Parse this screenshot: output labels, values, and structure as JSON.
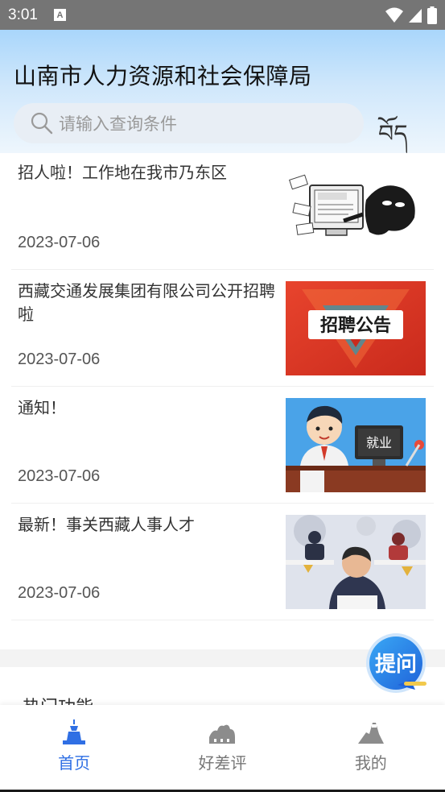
{
  "status_bar": {
    "time": "3:01",
    "notification_icon": "A"
  },
  "header": {
    "title": "山南市人力资源和社会保障局",
    "search_placeholder": "请输入查询条件",
    "language_toggle": "བོད"
  },
  "news": [
    {
      "title": "招人啦！工作地在我市乃东区",
      "date": "2023-07-06",
      "thumb": "online-recruitment-fraud-illustration"
    },
    {
      "title": "西藏交通发展集团有限公司公开招聘啦",
      "date": "2023-07-06",
      "thumb": "recruitment-announcement-banner",
      "thumb_text": "招聘公告"
    },
    {
      "title": "通知！",
      "date": "2023-07-06",
      "thumb": "employment-illustration",
      "thumb_text": "就业"
    },
    {
      "title": "最新！事关西藏人事人才",
      "date": "2023-07-06",
      "thumb": "office-worker-illustration"
    }
  ],
  "section": {
    "title": "热门功能"
  },
  "fab": {
    "label": "提问"
  },
  "bottom_nav": [
    {
      "label": "首页",
      "icon": "temple-icon",
      "active": true
    },
    {
      "label": "好差评",
      "icon": "palace-icon",
      "active": false
    },
    {
      "label": "我的",
      "icon": "mountain-icon",
      "active": false
    }
  ],
  "colors": {
    "accent": "#2f6fe4",
    "header_top": "#a9d6fb",
    "status_bar": "#757575"
  }
}
